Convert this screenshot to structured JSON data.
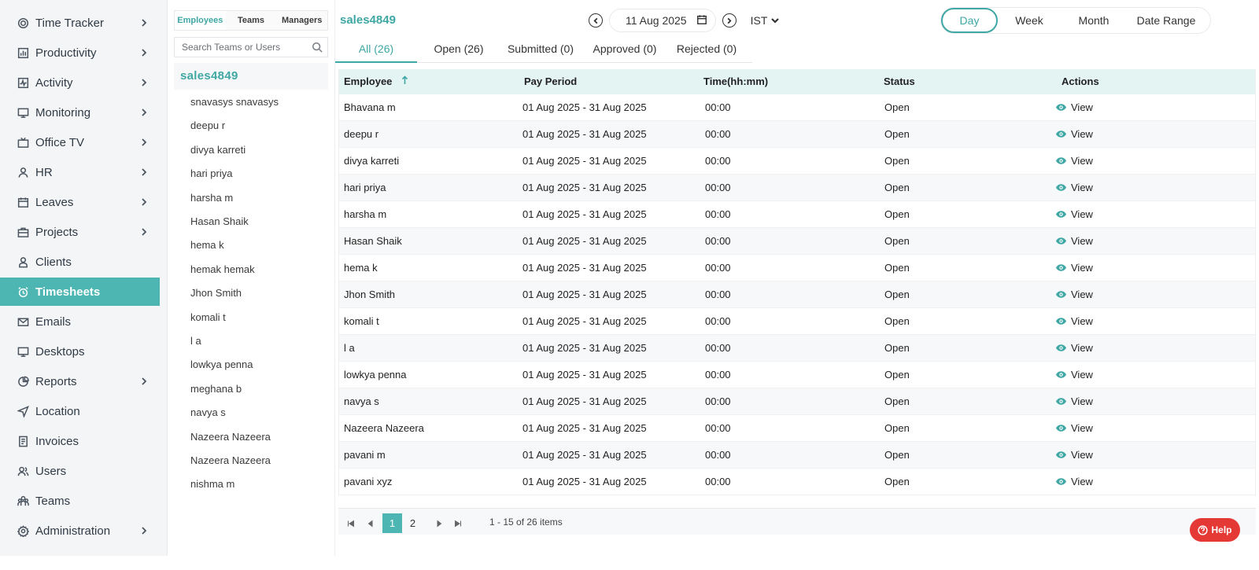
{
  "sidebar": {
    "items": [
      {
        "label": "Time Tracker",
        "icon": "clock-target-icon",
        "chevron": true
      },
      {
        "label": "Productivity",
        "icon": "bar-chart-icon",
        "chevron": true
      },
      {
        "label": "Activity",
        "icon": "activity-icon",
        "chevron": true
      },
      {
        "label": "Monitoring",
        "icon": "monitor-icon",
        "chevron": true
      },
      {
        "label": "Office TV",
        "icon": "tv-icon",
        "chevron": true
      },
      {
        "label": "HR",
        "icon": "person-icon",
        "chevron": true
      },
      {
        "label": "Leaves",
        "icon": "calendar-icon",
        "chevron": true
      },
      {
        "label": "Projects",
        "icon": "briefcase-icon",
        "chevron": true
      },
      {
        "label": "Clients",
        "icon": "client-icon",
        "chevron": false
      },
      {
        "label": "Timesheets",
        "icon": "alarm-clock-icon",
        "chevron": false,
        "active": true
      },
      {
        "label": "Emails",
        "icon": "mail-icon",
        "chevron": false
      },
      {
        "label": "Desktops",
        "icon": "desktop-icon",
        "chevron": false
      },
      {
        "label": "Reports",
        "icon": "pie-chart-icon",
        "chevron": true
      },
      {
        "label": "Location",
        "icon": "location-arrow-icon",
        "chevron": false
      },
      {
        "label": "Invoices",
        "icon": "invoice-icon",
        "chevron": false
      },
      {
        "label": "Users",
        "icon": "users-icon",
        "chevron": false
      },
      {
        "label": "Teams",
        "icon": "teams-icon",
        "chevron": false
      },
      {
        "label": "Administration",
        "icon": "settings-icon",
        "chevron": true
      }
    ]
  },
  "panel": {
    "tabs": {
      "employees": "Employees",
      "teams": "Teams",
      "managers": "Managers"
    },
    "search_placeholder": "Search Teams or Users",
    "team_name": "sales4849",
    "users": [
      "snavasys snavasys",
      "deepu r",
      "divya karreti",
      "hari priya",
      "harsha m",
      "Hasan Shaik",
      "hema k",
      "hemak hemak",
      "Jhon Smith",
      "komali t",
      "l a",
      "lowkya penna",
      "meghana b",
      "navya s",
      "Nazeera Nazeera",
      "Nazeera Nazeera",
      "nishma m"
    ]
  },
  "main": {
    "title": "sales4849",
    "date": "11 Aug 2025",
    "timezone": "IST",
    "range_tabs": {
      "day": "Day",
      "week": "Week",
      "month": "Month",
      "date_range": "Date Range"
    },
    "status_tabs": {
      "all": "All (26)",
      "open": "Open (26)",
      "submitted": "Submitted (0)",
      "approved": "Approved (0)",
      "rejected": "Rejected (0)"
    }
  },
  "table": {
    "columns": {
      "employee": "Employee",
      "pay_period": "Pay Period",
      "time": "Time(hh:mm)",
      "status": "Status",
      "actions": "Actions"
    },
    "action_label": "View",
    "rows": [
      {
        "employee": "Bhavana m",
        "pay_period": "01 Aug 2025 - 31 Aug 2025",
        "time": "00:00",
        "status": "Open"
      },
      {
        "employee": "deepu r",
        "pay_period": "01 Aug 2025 - 31 Aug 2025",
        "time": "00:00",
        "status": "Open"
      },
      {
        "employee": "divya karreti",
        "pay_period": "01 Aug 2025 - 31 Aug 2025",
        "time": "00:00",
        "status": "Open"
      },
      {
        "employee": "hari priya",
        "pay_period": "01 Aug 2025 - 31 Aug 2025",
        "time": "00:00",
        "status": "Open"
      },
      {
        "employee": "harsha m",
        "pay_period": "01 Aug 2025 - 31 Aug 2025",
        "time": "00:00",
        "status": "Open"
      },
      {
        "employee": "Hasan Shaik",
        "pay_period": "01 Aug 2025 - 31 Aug 2025",
        "time": "00:00",
        "status": "Open"
      },
      {
        "employee": "hema k",
        "pay_period": "01 Aug 2025 - 31 Aug 2025",
        "time": "00:00",
        "status": "Open"
      },
      {
        "employee": "Jhon Smith",
        "pay_period": "01 Aug 2025 - 31 Aug 2025",
        "time": "00:00",
        "status": "Open"
      },
      {
        "employee": "komali t",
        "pay_period": "01 Aug 2025 - 31 Aug 2025",
        "time": "00:00",
        "status": "Open"
      },
      {
        "employee": "l a",
        "pay_period": "01 Aug 2025 - 31 Aug 2025",
        "time": "00:00",
        "status": "Open"
      },
      {
        "employee": "lowkya penna",
        "pay_period": "01 Aug 2025 - 31 Aug 2025",
        "time": "00:00",
        "status": "Open"
      },
      {
        "employee": "navya s",
        "pay_period": "01 Aug 2025 - 31 Aug 2025",
        "time": "00:00",
        "status": "Open"
      },
      {
        "employee": "Nazeera Nazeera",
        "pay_period": "01 Aug 2025 - 31 Aug 2025",
        "time": "00:00",
        "status": "Open"
      },
      {
        "employee": "pavani m",
        "pay_period": "01 Aug 2025 - 31 Aug 2025",
        "time": "00:00",
        "status": "Open"
      },
      {
        "employee": "pavani xyz",
        "pay_period": "01 Aug 2025 - 31 Aug 2025",
        "time": "00:00",
        "status": "Open"
      }
    ]
  },
  "pagination": {
    "pages": [
      "1",
      "2"
    ],
    "current": "1",
    "info": "1 - 15 of 26 items"
  },
  "help": {
    "label": "Help"
  },
  "colors": {
    "accent": "#4db6b2",
    "accent_text": "#3fa7a4",
    "header_bg": "#e4f4f3",
    "help_bg": "#e53935"
  }
}
